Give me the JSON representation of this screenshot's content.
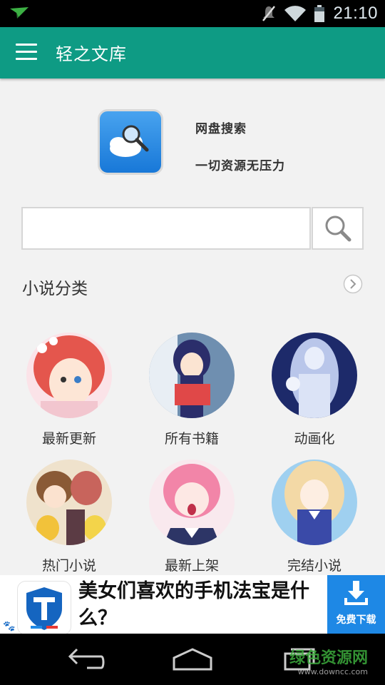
{
  "status_bar": {
    "time": "21:10"
  },
  "app_bar": {
    "title": "轻之文库"
  },
  "promo": {
    "title": "网盘搜索",
    "subtitle": "一切资源无压力"
  },
  "search": {
    "value": "",
    "placeholder": ""
  },
  "section": {
    "title": "小说分类"
  },
  "categories": [
    {
      "label": "最新更新"
    },
    {
      "label": "所有书籍"
    },
    {
      "label": "动画化"
    },
    {
      "label": "热门小说"
    },
    {
      "label": "最新上架"
    },
    {
      "label": "完结小说"
    }
  ],
  "ad": {
    "text": "美女们喜欢的手机法宝是什么？",
    "download_label": "免费下载"
  },
  "watermark": {
    "text": "绿色资源网",
    "url": "www.downcc.com"
  },
  "colors": {
    "primary": "#0e9b84",
    "download": "#1e88e5"
  }
}
